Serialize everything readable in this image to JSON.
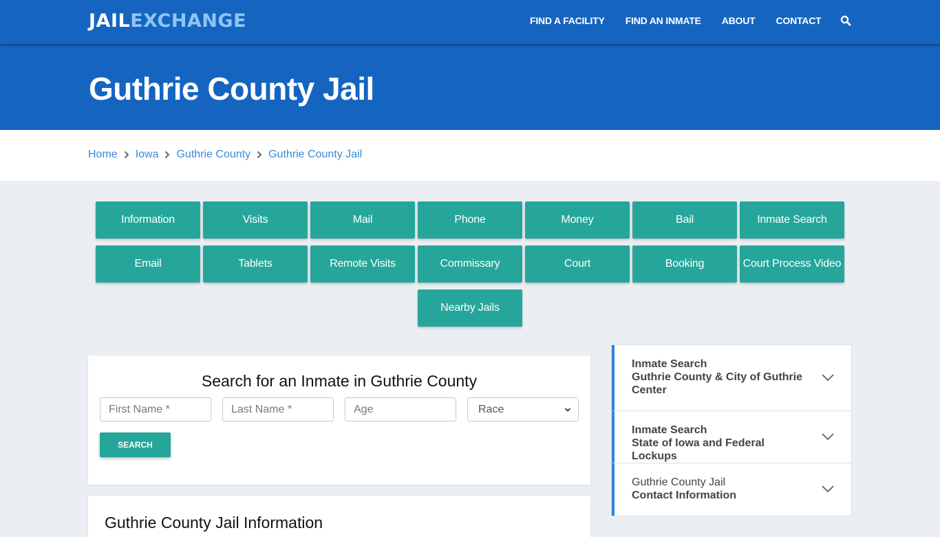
{
  "header": {
    "logo_part1": "JAIL",
    "logo_part2": "EXCHANGE",
    "nav": [
      {
        "label": "FIND A FACILITY"
      },
      {
        "label": "FIND AN INMATE"
      },
      {
        "label": "ABOUT"
      },
      {
        "label": "CONTACT"
      }
    ],
    "search_icon": "search-icon"
  },
  "hero": {
    "title": "Guthrie County Jail"
  },
  "breadcrumb": [
    {
      "label": "Home"
    },
    {
      "label": "Iowa"
    },
    {
      "label": "Guthrie County"
    },
    {
      "label": "Guthrie County Jail"
    }
  ],
  "tiles": [
    {
      "label": "Information"
    },
    {
      "label": "Visits"
    },
    {
      "label": "Mail"
    },
    {
      "label": "Phone"
    },
    {
      "label": "Money"
    },
    {
      "label": "Bail"
    },
    {
      "label": "Inmate Search"
    },
    {
      "label": "Email"
    },
    {
      "label": "Tablets"
    },
    {
      "label": "Remote Visits"
    },
    {
      "label": "Commissary"
    },
    {
      "label": "Court"
    },
    {
      "label": "Booking"
    },
    {
      "label": "Court Process Video"
    },
    {
      "label": "Nearby Jails"
    }
  ],
  "search_form": {
    "title": "Search for an Inmate in Guthrie County",
    "first_name_placeholder": "First Name *",
    "last_name_placeholder": "Last Name *",
    "age_placeholder": "Age",
    "race_selected": "Race",
    "submit_label": "SEARCH"
  },
  "info_section": {
    "title": "Guthrie County Jail Information"
  },
  "accordion": [
    {
      "line1": "Inmate Search",
      "line2": "Guthrie County & City of Guthrie Center"
    },
    {
      "line1": "Inmate Search",
      "line2": "State of Iowa and Federal Lockups"
    },
    {
      "line1": "Guthrie County Jail",
      "line2": "Contact Information"
    }
  ],
  "colors": {
    "brand_blue": "#1565c0",
    "logo_accent": "#8ec5f7",
    "teal": "#26a69a",
    "link_blue": "#3a8ad6",
    "accordion_accent": "#2d86d6"
  }
}
